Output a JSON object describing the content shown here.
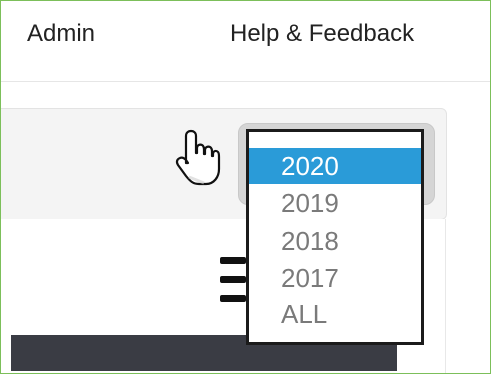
{
  "nav": {
    "admin_label": "Admin",
    "help_label": "Help & Feedback"
  },
  "year_dropdown": {
    "selected": "2020",
    "options": [
      "2020",
      "2019",
      "2018",
      "2017",
      "ALL"
    ]
  },
  "icons": {
    "cursor": "hand-pointer-icon",
    "menu": "hamburger-icon"
  },
  "colors": {
    "selected_option": "#2a9bd8",
    "frame_border": "#7cbf5a",
    "dark_bar": "#3a3c44"
  }
}
